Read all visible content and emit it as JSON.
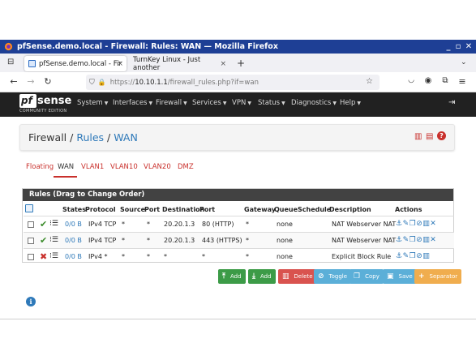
{
  "window": {
    "title": "pfSense.demo.local - Firewall: Rules: WAN — Mozilla Firefox"
  },
  "tabs": [
    {
      "label": "pfSense.demo.local - Fir",
      "close": "×"
    },
    {
      "label": "TurnKey Linux - Just another",
      "close": "×"
    }
  ],
  "new_tab": "+",
  "url": {
    "prefix": "https://",
    "host": "10.10.1.1",
    "path": "/firewall_rules.php?if=wan"
  },
  "brand": {
    "pf": "pf",
    "sense": "sense",
    "edition": "COMMUNITY EDITION"
  },
  "menu": [
    "System",
    "Interfaces",
    "Firewall",
    "Services",
    "VPN",
    "Status",
    "Diagnostics",
    "Help"
  ],
  "breadcrumb": {
    "root": "Firewall",
    "mid": "Rules",
    "leaf": "WAN",
    "sep": "/"
  },
  "subtabs": [
    "Floating",
    "WAN",
    "VLAN1",
    "VLAN10",
    "VLAN20",
    "DMZ"
  ],
  "panel_title": "Rules (Drag to Change Order)",
  "columns": [
    "States",
    "Protocol",
    "Source",
    "Port",
    "Destination",
    "Port",
    "Gateway",
    "Queue",
    "Schedule",
    "Description",
    "Actions"
  ],
  "rules": [
    {
      "states": "0/0 B",
      "protocol": "IPv4 TCP",
      "source": "*",
      "sport": "*",
      "destination": "20.20.1.3",
      "dport": "80 (HTTP)",
      "gateway": "*",
      "queue": "none",
      "schedule": "",
      "description": "NAT Webserver NAT"
    },
    {
      "states": "0/0 B",
      "protocol": "IPv4 TCP",
      "source": "*",
      "sport": "*",
      "destination": "20.20.1.3",
      "dport": "443 (HTTPS)",
      "gateway": "*",
      "queue": "none",
      "schedule": "",
      "description": "NAT Webserver NAT"
    },
    {
      "states": "0/0 B",
      "protocol": "IPv4 *",
      "source": "*",
      "sport": "*",
      "destination": "*",
      "dport": "*",
      "gateway": "*",
      "queue": "none",
      "schedule": "",
      "description": "Explicit Block Rule"
    }
  ],
  "buttons": [
    {
      "label": "Add",
      "icon": "arrow-up-icon"
    },
    {
      "label": "Add",
      "icon": "arrow-down-icon"
    },
    {
      "label": "Delete",
      "icon": "trash-icon"
    },
    {
      "label": "Toggle",
      "icon": "ban-icon"
    },
    {
      "label": "Copy",
      "icon": "copy-icon"
    },
    {
      "label": "Save",
      "icon": "save-icon"
    },
    {
      "label": "Separator",
      "icon": "plus-icon"
    }
  ],
  "colors": {
    "titlebar": "#1e3f95",
    "header": "#212121",
    "accent_blue": "#2e79b9",
    "accent_red": "#c9302c",
    "green": "#3c9b47",
    "orange": "#f0ad4e"
  }
}
